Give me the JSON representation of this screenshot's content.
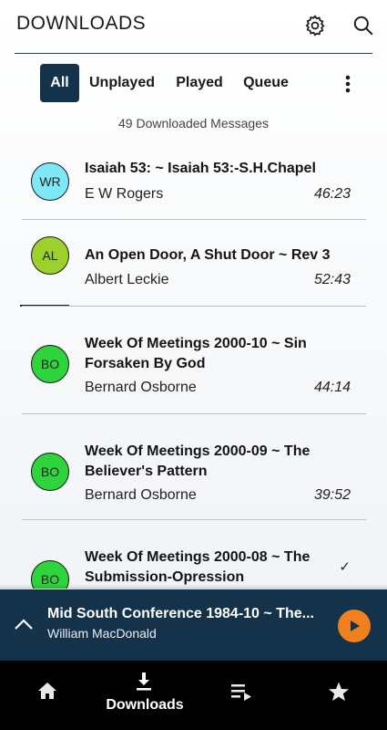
{
  "header": {
    "title": "DOWNLOADS",
    "settings_icon": "gear-icon",
    "search_icon": "search-icon"
  },
  "filters": {
    "tabs": [
      {
        "label": "All",
        "active": true
      },
      {
        "label": "Unplayed",
        "active": false
      },
      {
        "label": "Played",
        "active": false
      },
      {
        "label": "Queue",
        "active": false
      }
    ],
    "more_icon": "more-vertical-icon"
  },
  "summary": "49 Downloaded Messages",
  "messages": [
    {
      "initials": "WR",
      "avatar_color": "#7fe8f6",
      "title": "Isaiah 53: ~ Isaiah 53:-S.H.Chapel",
      "speaker": "E W Rogers",
      "duration": "46:23"
    },
    {
      "initials": "AL",
      "avatar_color": "#9bd12a",
      "title": "An Open Door, A Shut Door ~ Rev 3",
      "speaker": "Albert Leckie",
      "duration": "52:43"
    },
    {
      "initials": "BO",
      "avatar_color": "#2fd43c",
      "title": "Week Of Meetings 2000-10 ~ Sin Forsaken By God",
      "speaker": "Bernard Osborne",
      "duration": "44:14"
    },
    {
      "initials": "BO",
      "avatar_color": "#2fd43c",
      "title": "Week Of Meetings 2000-09 ~ The Believer's Pattern",
      "speaker": "Bernard Osborne",
      "duration": "39:52"
    },
    {
      "initials": "BO",
      "avatar_color": "#2fd43c",
      "title": "Week Of Meetings 2000-08 ~ The Submission-Opression",
      "speaker": "",
      "duration": "",
      "played": true
    }
  ],
  "now_playing": {
    "title": "Mid South Conference 1984-10 ~ The...",
    "speaker": "William MacDonald",
    "play_color": "#f07f1e"
  },
  "bottom_nav": {
    "items": [
      {
        "icon": "home-icon",
        "label": ""
      },
      {
        "icon": "download-icon",
        "label": "Downloads"
      },
      {
        "icon": "queue-icon",
        "label": ""
      },
      {
        "icon": "star-icon",
        "label": ""
      }
    ]
  },
  "colors": {
    "primary": "#14324a",
    "accent": "#f07f1e"
  }
}
